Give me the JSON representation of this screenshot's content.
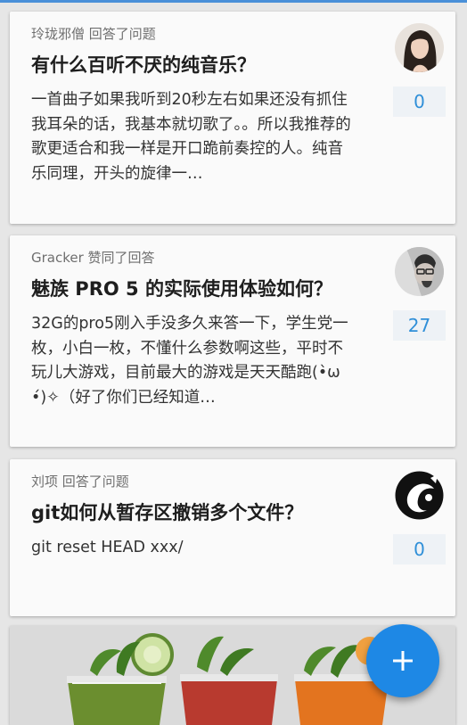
{
  "feed": [
    {
      "meta": "玲珑邪僧 回答了问题",
      "title": "有什么百听不厌的纯音乐？",
      "excerpt": "一首曲子如果我听到20秒左右如果还没有抓住我耳朵的话，我基本就切歌了。。所以我推荐的歌更适合和我一样是开口跪前奏控的人。纯音乐同理，开头的旋律一…",
      "count": "0",
      "avatar_icon": "user-avatar-woman"
    },
    {
      "meta": "Gracker 赞同了回答",
      "title": "魅族 PRO 5 的实际使用体验如何？",
      "excerpt": "32G的pro5刚入手没多久来答一下，学生党一枚，小白一枚，不懂什么参数啊这些，平时不玩儿大游戏，目前最大的游戏是天天酷跑(•̀ω•́)✧（好了你们已经知道…",
      "count": "27",
      "avatar_icon": "user-avatar-man-glasses"
    },
    {
      "meta": "刘项 回答了问题",
      "title": "git如何从暂存区撤销多个文件？",
      "excerpt": "git reset HEAD xxx/",
      "count": "0",
      "avatar_icon": "user-avatar-dark-logo"
    }
  ],
  "image_card": {
    "icon": "juice-glasses-photo"
  },
  "fab": {
    "icon": "plus-icon",
    "color": "#1e88e5"
  },
  "colors": {
    "accent": "#2f8fd8",
    "count_bg": "#eef2f6"
  }
}
